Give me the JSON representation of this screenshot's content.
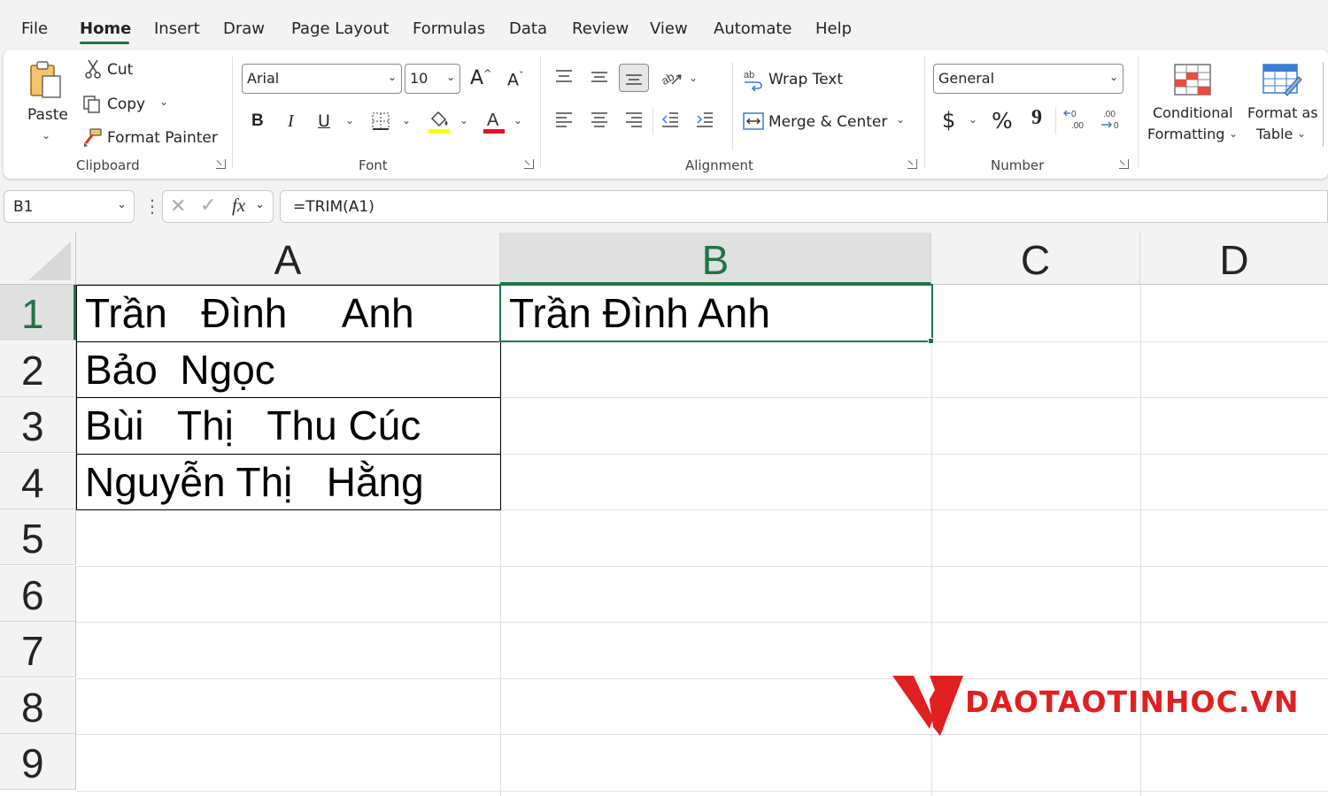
{
  "menu": {
    "tabs": [
      "File",
      "Home",
      "Insert",
      "Draw",
      "Page Layout",
      "Formulas",
      "Data",
      "Review",
      "View",
      "Automate",
      "Help"
    ],
    "active": "Home"
  },
  "ribbon": {
    "clipboard": {
      "label": "Clipboard",
      "paste": "Paste",
      "cut": "Cut",
      "copy": "Copy",
      "format_painter": "Format Painter"
    },
    "font": {
      "label": "Font",
      "font_name": "Arial",
      "font_size": "10",
      "bold": "B",
      "italic": "I",
      "underline": "U",
      "highlight_color": "#ffff00",
      "font_color": "#e81123"
    },
    "alignment": {
      "label": "Alignment",
      "wrap_text": "Wrap Text",
      "merge_center": "Merge & Center"
    },
    "number": {
      "label": "Number",
      "format": "General",
      "currency": "$",
      "percent": "%",
      "comma": "9"
    },
    "styles": {
      "conditional_formatting_1": "Conditional",
      "conditional_formatting_2": "Formatting",
      "format_as_table_1": "Format as",
      "format_as_table_2": "Table"
    }
  },
  "formula_bar": {
    "name_box": "B1",
    "fx": "fx",
    "formula": "=TRIM(A1)"
  },
  "sheet": {
    "columns": [
      "A",
      "B",
      "C",
      "D"
    ],
    "selected_column": "B",
    "rows": [
      "1",
      "2",
      "3",
      "4",
      "5",
      "6",
      "7",
      "8",
      "9"
    ],
    "selected_row": "1",
    "cells": {
      "A1": "Trần   Đình     Anh",
      "A2": "Bảo  Ngọc",
      "A3": "Bùi   Thị   Thu Cúc",
      "A4": "Nguyễn Thị   Hằng",
      "B1": "Trần Đình Anh"
    },
    "accent_color": "#217346"
  },
  "watermark": {
    "text": "DAOTAOTINHOC.VN",
    "color": "#e02020"
  }
}
